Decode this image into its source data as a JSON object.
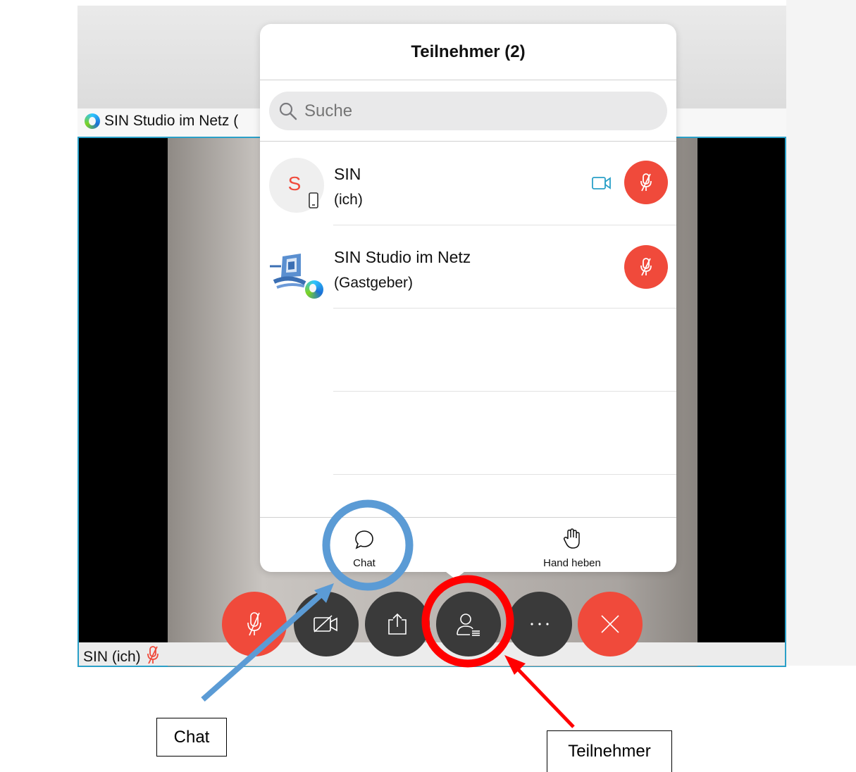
{
  "host_tile": {
    "label": "SIN Studio im Netz ("
  },
  "self_tile": {
    "label": "SIN (ich)"
  },
  "panel": {
    "title": "Teilnehmer (2)",
    "search_placeholder": "Suche",
    "participants": [
      {
        "avatar_letter": "S",
        "name": "SIN",
        "role": "(ich)",
        "video": true,
        "muted": true
      },
      {
        "name": "SIN Studio im Netz",
        "role": "(Gastgeber)",
        "video": false,
        "muted": true
      }
    ],
    "actions": {
      "chat_label": "Chat",
      "raise_hand_label": "Hand heben"
    }
  },
  "controls": [
    "microphone-muted-icon",
    "video-off-icon",
    "share-icon",
    "participants-icon",
    "more-icon",
    "leave-icon"
  ],
  "annotations": {
    "chat_label": "Chat",
    "participants_label": "Teilnehmer"
  },
  "colors": {
    "red": "#f04a3b",
    "dark_button": "#3a3a3a",
    "accent_blue": "#2aa0c8",
    "chat_ring": "#5b9bd5",
    "highlight_red": "#ff0000"
  }
}
